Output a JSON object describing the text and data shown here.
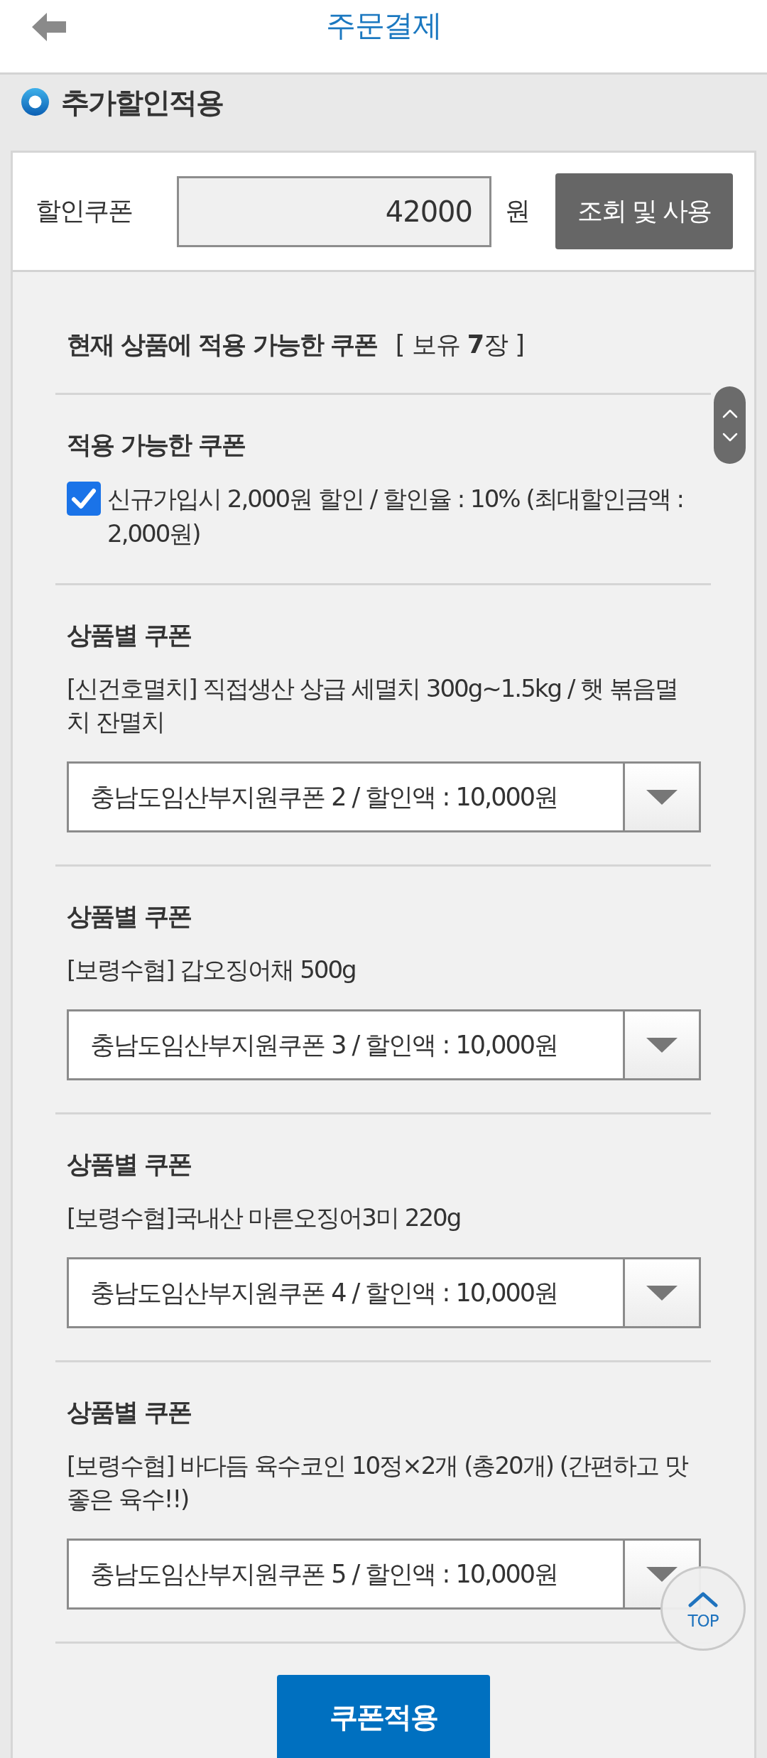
{
  "header": {
    "title": "주문결제"
  },
  "section": {
    "title": "추가할인적용"
  },
  "discount_coupon": {
    "label": "할인쿠폰",
    "value": "42000",
    "unit": "원",
    "button": "조회 및 사용"
  },
  "available": {
    "title": "현재 상품에 적용 가능한 쿠폰",
    "count": "[ 보유 **7**장 ]"
  },
  "groups": [
    {
      "kind": "checkbox",
      "title": "적용 가능한 쿠폰",
      "items": [
        {
          "label": "신규가입시 2,000원 할인 / 할인율 : 10% (최대할인금액 : 2,000원)",
          "checked": true
        }
      ]
    },
    {
      "kind": "select",
      "title": "상품별 쿠폰",
      "product": "[신건호멸치] 직접생산 상급 세멸치 300g~1.5kg / 햇 볶음멸치 잔멸치",
      "value": "충남도임산부지원쿠폰 2 / 할인액 : 10,000원"
    },
    {
      "kind": "select",
      "title": "상품별 쿠폰",
      "product": "[보령수협] 갑오징어채 500g",
      "value": "충남도임산부지원쿠폰 3 / 할인액 : 10,000원"
    },
    {
      "kind": "select",
      "title": "상품별 쿠폰",
      "product": "[보령수협]국내산 마른오징어3미 220g",
      "value": "충남도임산부지원쿠폰 4 / 할인액 : 10,000원"
    },
    {
      "kind": "select",
      "title": "상품별 쿠폰",
      "product": "[보령수협] 바다듬 육수코인 10정×2개 (총20개) (간편하고 맛좋은 육수!!)",
      "value": "충남도임산부지원쿠폰 5 / 할인액 : 10,000원"
    }
  ],
  "apply_button": "쿠폰적용",
  "top_button": {
    "label": "TOP"
  }
}
